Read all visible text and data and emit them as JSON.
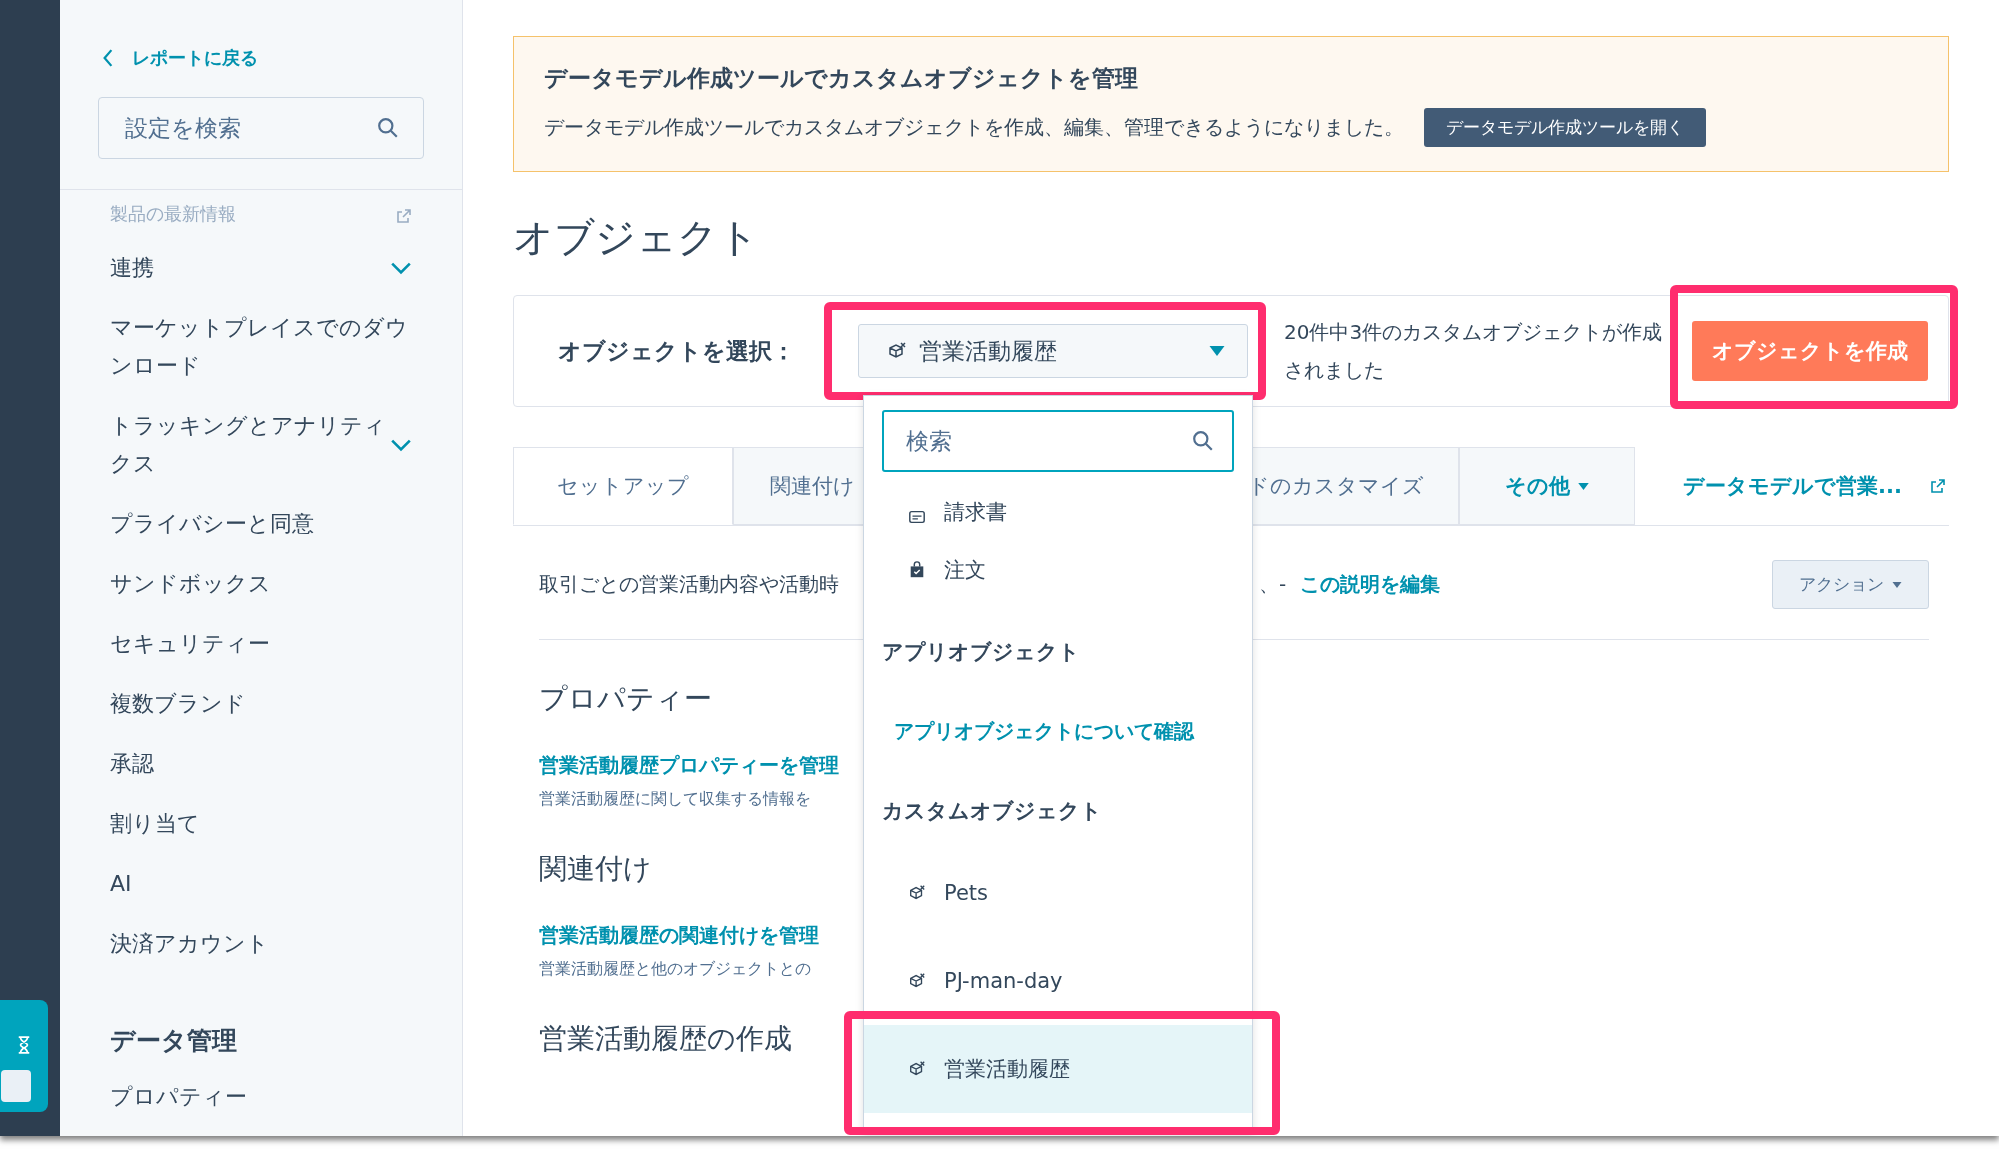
{
  "sidebar": {
    "back_link": "レポートに戻る",
    "search": {
      "placeholder": "設定を検索"
    },
    "items": [
      {
        "label": "製品の最新情報",
        "kind": "external"
      },
      {
        "label": "連携",
        "kind": "group"
      },
      {
        "label": "マーケットプレイスでのダウンロード",
        "kind": "link"
      },
      {
        "label": "トラッキングとアナリティクス",
        "kind": "group"
      },
      {
        "label": "プライバシーと同意",
        "kind": "link"
      },
      {
        "label": "サンドボックス",
        "kind": "link"
      },
      {
        "label": "セキュリティー",
        "kind": "link"
      },
      {
        "label": "複数ブランド",
        "kind": "link"
      },
      {
        "label": "承認",
        "kind": "link"
      },
      {
        "label": "割り当て",
        "kind": "link"
      },
      {
        "label": "AI",
        "kind": "link"
      },
      {
        "label": "決済アカウント",
        "kind": "link"
      },
      {
        "label": "データ管理",
        "kind": "heading"
      },
      {
        "label": "プロパティー",
        "kind": "link"
      }
    ]
  },
  "banner": {
    "title": "データモデル作成ツールでカスタムオブジェクトを管理",
    "text": "データモデル作成ツールでカスタムオブジェクトを作成、編集、管理できるようになりました。",
    "button": "データモデル作成ツールを開く"
  },
  "page_title": "オブジェクト",
  "selector": {
    "label": "オブジェクトを選択：",
    "value": "営業活動履歴",
    "highlighted": true,
    "description": "20件中3件のカスタムオブジェクトが作成されました",
    "create_button": {
      "label": "オブジェクトを作成",
      "highlighted": true
    }
  },
  "tabs": [
    {
      "label": "セットアップ",
      "selected": true,
      "kind": "tab"
    },
    {
      "label": "関連付け",
      "selected": false,
      "kind": "tab"
    },
    {
      "label": "ドのカスタマイズ",
      "selected": false,
      "kind": "tab"
    },
    {
      "label": "その他",
      "selected": false,
      "kind": "menu"
    }
  ],
  "tab_link": "データモデルで営業...",
  "description": {
    "text": "取引ごとの営業活動内容や活動時",
    "tail": "、-",
    "link": "この説明を編集"
  },
  "action_button": "アクション",
  "sections": [
    {
      "heading": "プロパティー",
      "link": "営業活動履歴プロパティーを管理",
      "text": "営業活動履歴に関して収集する情報を"
    },
    {
      "heading": "関連付け",
      "link": "営業活動履歴の関連付けを管理",
      "text": "営業活動履歴と他のオブジェクトとの"
    },
    {
      "heading": "営業活動履歴の作成"
    }
  ],
  "dropdown": {
    "search": {
      "placeholder": "検索"
    },
    "entries": [
      {
        "label": "請求書",
        "kind": "invoice",
        "selected": false,
        "highlighted": false
      },
      {
        "label": "注文",
        "kind": "order",
        "selected": false,
        "highlighted": false
      },
      {
        "label": "アプリオブジェクト",
        "kind": "header"
      },
      {
        "label": "アプリオブジェクトについて確認",
        "kind": "link"
      },
      {
        "label": "カスタムオブジェクト",
        "kind": "header"
      },
      {
        "label": "Pets",
        "kind": "custom",
        "selected": false,
        "highlighted": false
      },
      {
        "label": "PJ-man-day",
        "kind": "custom",
        "selected": false,
        "highlighted": false
      },
      {
        "label": "営業活動履歴",
        "kind": "custom",
        "selected": true,
        "highlighted": true
      }
    ]
  }
}
